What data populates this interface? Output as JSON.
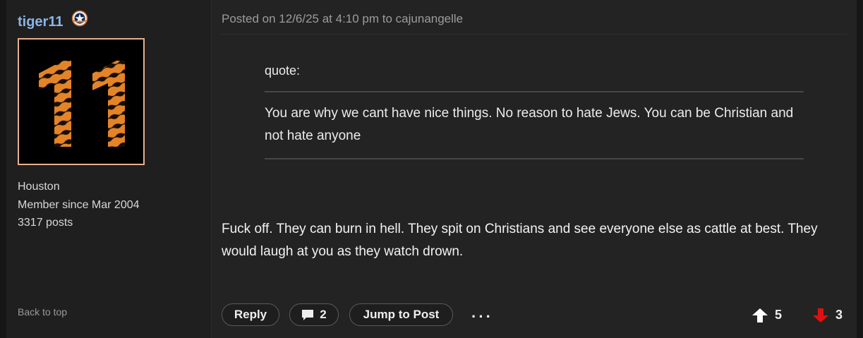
{
  "user": {
    "name": "tiger11",
    "team_badge_icon": "astros-star-badge-icon",
    "avatar_text": "11",
    "location": "Houston",
    "member_since": "Member since Mar 2004",
    "posts": "3317 posts",
    "back_to_top": "Back to top"
  },
  "post": {
    "header": "Posted on 12/6/25 at 4:10 pm to cajunangelle",
    "quote_label": "quote:",
    "quote_text": "You are why we cant have nice things. No reason to hate Jews. You can be Christian and not hate anyone",
    "body": "Fuck off. They can burn in hell. They spit on Christians and see everyone else as cattle at best. They would laugh at you as they watch drown."
  },
  "actions": {
    "reply_label": "Reply",
    "comment_count": "2",
    "jump_label": "Jump to Post",
    "more_label": "···",
    "upvotes": "5",
    "downvotes": "3"
  },
  "colors": {
    "username": "#8ab4e6",
    "upvote_arrow": "#ffffff",
    "downvote_arrow": "#e01010",
    "avatar_border": "#e8b090"
  }
}
